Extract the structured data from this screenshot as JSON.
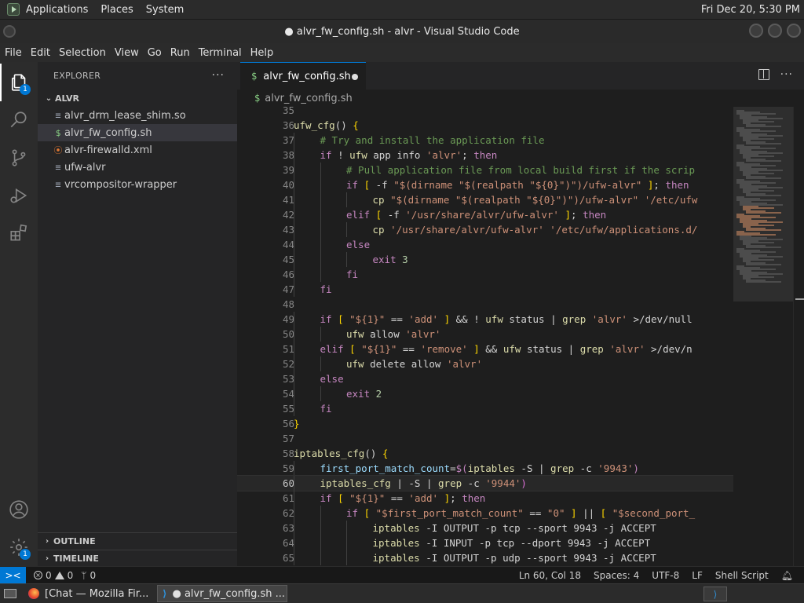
{
  "top_panel": {
    "menus": [
      "Applications",
      "Places",
      "System"
    ],
    "clock": "Fri Dec 20,  5:30 PM"
  },
  "window": {
    "title": "● alvr_fw_config.sh - alvr - Visual Studio Code"
  },
  "menu_bar": [
    "File",
    "Edit",
    "Selection",
    "View",
    "Go",
    "Run",
    "Terminal",
    "Help"
  ],
  "activity_bar": {
    "explorer_badge": "1",
    "manage_badge": "1"
  },
  "sidebar": {
    "title": "EXPLORER",
    "folder": "ALVR",
    "files": [
      {
        "name": "alvr_drm_lease_shim.so",
        "icon": "lines-icon",
        "selected": false
      },
      {
        "name": "alvr_fw_config.sh",
        "icon": "dollar-icon",
        "selected": true
      },
      {
        "name": "alvr-firewalld.xml",
        "icon": "rss-icon",
        "selected": false
      },
      {
        "name": "ufw-alvr",
        "icon": "lines-icon",
        "selected": false
      },
      {
        "name": "vrcompositor-wrapper",
        "icon": "lines-icon",
        "selected": false
      }
    ],
    "outline": "OUTLINE",
    "timeline": "TIMELINE"
  },
  "editor": {
    "tab_label": "alvr_fw_config.sh",
    "breadcrumb": "alvr_fw_config.sh",
    "current_line": 60,
    "lines": [
      {
        "n": 35,
        "i": 0,
        "t": []
      },
      {
        "n": 36,
        "i": 0,
        "t": [
          [
            "fn",
            "ufw_cfg"
          ],
          [
            "op",
            "() "
          ],
          [
            "br",
            "{"
          ]
        ]
      },
      {
        "n": 37,
        "i": 1,
        "t": [
          [
            "cm",
            "# Try and install the application file"
          ]
        ]
      },
      {
        "n": 38,
        "i": 1,
        "t": [
          [
            "kw",
            "if"
          ],
          [
            "op",
            " ! "
          ],
          [
            "cmd",
            "ufw"
          ],
          [
            "op",
            " app info "
          ],
          [
            "str",
            "'alvr'"
          ],
          [
            "op",
            "; "
          ],
          [
            "kw",
            "then"
          ]
        ]
      },
      {
        "n": 39,
        "i": 2,
        "t": [
          [
            "cm",
            "# Pull application file from local build first if the scrip"
          ]
        ]
      },
      {
        "n": 40,
        "i": 2,
        "t": [
          [
            "kw",
            "if"
          ],
          [
            "op",
            " "
          ],
          [
            "br",
            "["
          ],
          [
            "op",
            " -f "
          ],
          [
            "str",
            "\"$(dirname \"$(realpath \"${0}\")\")/ufw-alvr\""
          ],
          [
            "op",
            " "
          ],
          [
            "br",
            "]"
          ],
          [
            "op",
            "; "
          ],
          [
            "kw",
            "then"
          ]
        ]
      },
      {
        "n": 41,
        "i": 3,
        "t": [
          [
            "cmd",
            "cp"
          ],
          [
            "op",
            " "
          ],
          [
            "str",
            "\"$(dirname \"$(realpath \"${0}\")\")/ufw-alvr\""
          ],
          [
            "op",
            " "
          ],
          [
            "str",
            "'/etc/ufw"
          ]
        ]
      },
      {
        "n": 42,
        "i": 2,
        "t": [
          [
            "kw",
            "elif"
          ],
          [
            "op",
            " "
          ],
          [
            "br",
            "["
          ],
          [
            "op",
            " -f "
          ],
          [
            "str",
            "'/usr/share/alvr/ufw-alvr'"
          ],
          [
            "op",
            " "
          ],
          [
            "br",
            "]"
          ],
          [
            "op",
            "; "
          ],
          [
            "kw",
            "then"
          ]
        ]
      },
      {
        "n": 43,
        "i": 3,
        "t": [
          [
            "cmd",
            "cp"
          ],
          [
            "op",
            " "
          ],
          [
            "str",
            "'/usr/share/alvr/ufw-alvr'"
          ],
          [
            "op",
            " "
          ],
          [
            "str",
            "'/etc/ufw/applications.d/"
          ]
        ]
      },
      {
        "n": 44,
        "i": 2,
        "t": [
          [
            "kw",
            "else"
          ]
        ]
      },
      {
        "n": 45,
        "i": 3,
        "t": [
          [
            "kw",
            "exit"
          ],
          [
            "op",
            " "
          ],
          [
            "num",
            "3"
          ]
        ]
      },
      {
        "n": 46,
        "i": 2,
        "t": [
          [
            "kw",
            "fi"
          ]
        ]
      },
      {
        "n": 47,
        "i": 1,
        "t": [
          [
            "kw",
            "fi"
          ]
        ]
      },
      {
        "n": 48,
        "i": 0,
        "t": []
      },
      {
        "n": 49,
        "i": 1,
        "t": [
          [
            "kw",
            "if"
          ],
          [
            "op",
            " "
          ],
          [
            "br",
            "["
          ],
          [
            "op",
            " "
          ],
          [
            "str",
            "\"${1}\""
          ],
          [
            "op",
            " == "
          ],
          [
            "str",
            "'add'"
          ],
          [
            "op",
            " "
          ],
          [
            "br",
            "]"
          ],
          [
            "op",
            " && ! "
          ],
          [
            "cmd",
            "ufw"
          ],
          [
            "op",
            " status | "
          ],
          [
            "cmd",
            "grep"
          ],
          [
            "op",
            " "
          ],
          [
            "str",
            "'alvr'"
          ],
          [
            "op",
            " >/dev/null"
          ]
        ]
      },
      {
        "n": 50,
        "i": 2,
        "t": [
          [
            "cmd",
            "ufw"
          ],
          [
            "op",
            " allow "
          ],
          [
            "str",
            "'alvr'"
          ]
        ]
      },
      {
        "n": 51,
        "i": 1,
        "t": [
          [
            "kw",
            "elif"
          ],
          [
            "op",
            " "
          ],
          [
            "br",
            "["
          ],
          [
            "op",
            " "
          ],
          [
            "str",
            "\"${1}\""
          ],
          [
            "op",
            " == "
          ],
          [
            "str",
            "'remove'"
          ],
          [
            "op",
            " "
          ],
          [
            "br",
            "]"
          ],
          [
            "op",
            " && "
          ],
          [
            "cmd",
            "ufw"
          ],
          [
            "op",
            " status | "
          ],
          [
            "cmd",
            "grep"
          ],
          [
            "op",
            " "
          ],
          [
            "str",
            "'alvr'"
          ],
          [
            "op",
            " >/dev/n"
          ]
        ]
      },
      {
        "n": 52,
        "i": 2,
        "t": [
          [
            "cmd",
            "ufw"
          ],
          [
            "op",
            " delete allow "
          ],
          [
            "str",
            "'alvr'"
          ]
        ]
      },
      {
        "n": 53,
        "i": 1,
        "t": [
          [
            "kw",
            "else"
          ]
        ]
      },
      {
        "n": 54,
        "i": 2,
        "t": [
          [
            "kw",
            "exit"
          ],
          [
            "op",
            " "
          ],
          [
            "num",
            "2"
          ]
        ]
      },
      {
        "n": 55,
        "i": 1,
        "t": [
          [
            "kw",
            "fi"
          ]
        ]
      },
      {
        "n": 56,
        "i": 0,
        "t": [
          [
            "br",
            "}"
          ]
        ]
      },
      {
        "n": 57,
        "i": 0,
        "t": []
      },
      {
        "n": 58,
        "i": 0,
        "t": [
          [
            "fn",
            "iptables_cfg"
          ],
          [
            "op",
            "() "
          ],
          [
            "br",
            "{"
          ]
        ]
      },
      {
        "n": 59,
        "i": 1,
        "t": [
          [
            "var",
            "first_port_match_count"
          ],
          [
            "op",
            "="
          ],
          [
            "kw",
            "$("
          ],
          [
            "cmd",
            "iptables"
          ],
          [
            "op",
            " -S | "
          ],
          [
            "cmd",
            "grep"
          ],
          [
            "op",
            " -c "
          ],
          [
            "str",
            "'9943'"
          ],
          [
            "kw",
            ")"
          ]
        ]
      },
      {
        "n": 60,
        "i": 1,
        "t": [
          [
            "cmd",
            "iptables_cfg"
          ],
          [
            "op",
            " "
          ],
          [
            "op",
            "| -S | "
          ],
          [
            "cmd",
            "grep"
          ],
          [
            "op",
            " -c "
          ],
          [
            "str",
            "'9944'"
          ],
          [
            "br2",
            ")"
          ]
        ]
      },
      {
        "n": 61,
        "i": 1,
        "t": [
          [
            "kw",
            "if"
          ],
          [
            "op",
            " "
          ],
          [
            "br",
            "["
          ],
          [
            "op",
            " "
          ],
          [
            "str",
            "\"${1}\""
          ],
          [
            "op",
            " == "
          ],
          [
            "str",
            "'add'"
          ],
          [
            "op",
            " "
          ],
          [
            "br",
            "]"
          ],
          [
            "op",
            "; "
          ],
          [
            "kw",
            "then"
          ]
        ]
      },
      {
        "n": 62,
        "i": 2,
        "t": [
          [
            "kw",
            "if"
          ],
          [
            "op",
            " "
          ],
          [
            "br",
            "["
          ],
          [
            "op",
            " "
          ],
          [
            "str",
            "\"$first_port_match_count\""
          ],
          [
            "op",
            " == "
          ],
          [
            "str",
            "\"0\""
          ],
          [
            "op",
            " "
          ],
          [
            "br",
            "]"
          ],
          [
            "op",
            " || "
          ],
          [
            "br",
            "["
          ],
          [
            "op",
            " "
          ],
          [
            "str",
            "\"$second_port_"
          ]
        ]
      },
      {
        "n": 63,
        "i": 3,
        "t": [
          [
            "cmd",
            "iptables"
          ],
          [
            "op",
            " -I OUTPUT -p tcp --sport 9943 -j ACCEPT"
          ]
        ]
      },
      {
        "n": 64,
        "i": 3,
        "t": [
          [
            "cmd",
            "iptables"
          ],
          [
            "op",
            " -I INPUT -p tcp --dport 9943 -j ACCEPT"
          ]
        ]
      },
      {
        "n": 65,
        "i": 3,
        "t": [
          [
            "cmd",
            "iptables"
          ],
          [
            "op",
            " -I OUTPUT -p udp --sport 9943 -j ACCEPT"
          ]
        ]
      }
    ]
  },
  "status_bar": {
    "remote": "><",
    "errors": "0",
    "warnings": "0",
    "ports": "0",
    "position": "Ln 60, Col 18",
    "spaces": "Spaces: 4",
    "encoding": "UTF-8",
    "eol": "LF",
    "language": "Shell Script"
  },
  "taskbar": {
    "tasks": [
      {
        "label": "[Chat — Mozilla Fir...",
        "icon": "firefox-icon",
        "active": false
      },
      {
        "label": "● alvr_fw_config.sh ...",
        "icon": "vscode-icon",
        "active": true
      }
    ]
  },
  "colors": {
    "accent": "#0078d4",
    "keyword": "#c586c0",
    "string": "#ce9178",
    "comment": "#6a9955",
    "function": "#dcdcaa"
  }
}
